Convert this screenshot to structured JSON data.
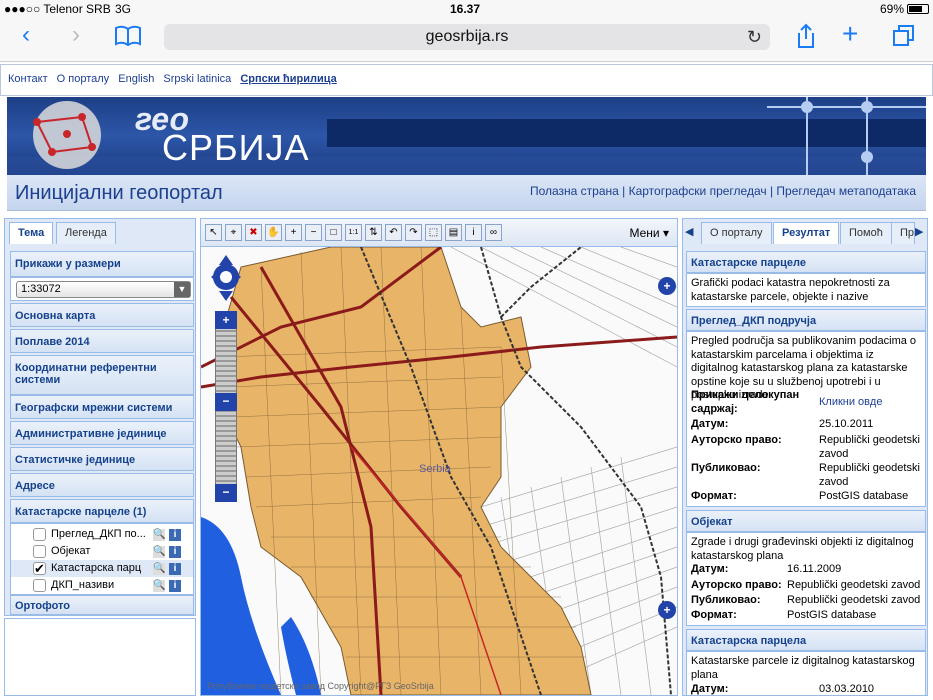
{
  "status": {
    "carrier": "●●●○○ Telenor SRB",
    "network": "3G",
    "time": "16.37",
    "battery": "69%"
  },
  "browser": {
    "url": "geosrbija.rs"
  },
  "toplinks": [
    "Контакт",
    "О порталу",
    "English",
    "Srpski latinica",
    "Српски ћирилица"
  ],
  "banner": {
    "geo": "гео",
    "srbija": "СРБИЈА"
  },
  "subtitle": {
    "title": "Иницијални геопортал",
    "nav": "Полазна страна | Картографски прегледач | Прегледач метаподатака"
  },
  "left": {
    "tabs": [
      "Тема",
      "Легенда"
    ],
    "scale_label": "Прикажи у размери",
    "scale_value": "1:33072",
    "sections": [
      "Основна карта",
      "Поплаве 2014",
      "Координатни референтни системи",
      "Географски мрежни системи",
      "Административне јединице",
      "Статистичке јединице",
      "Адресе",
      "Катастарске парцеле (1)",
      "Ортофото"
    ],
    "layers": [
      {
        "label": "Преглед_ДКП по...",
        "checked": false
      },
      {
        "label": "Објекат",
        "checked": false
      },
      {
        "label": "Катастарска парц",
        "checked": true
      },
      {
        "label": "ДКП_називи",
        "checked": false
      }
    ]
  },
  "map": {
    "menu": "Мени",
    "place": "Serbia",
    "copyright": "Републички геодетски завод Copyright@РГЗ GeoSrbija"
  },
  "right": {
    "tabs": [
      "О порталу",
      "Резултат",
      "Помоћ",
      "Пр"
    ],
    "s1_title": "Катастарске парцеле",
    "s1_text": "Grafički podaci katastra nepokretnosti za katastarske parcele, objekte i nazive",
    "s2_title": "Преглед_ДКП подручја",
    "s2_text": "Pregled područja sa publikovanim podacima o katastarskim parcelama i objektima iz digitalnog katastarskog plana za katastarske opstine koje su u službenoj upotrebi i u postupku izrade",
    "s2_show_k": "Прикажи целокупан садржај:",
    "s2_show_v": "Кликни овде",
    "s2_date_k": "Датум:",
    "s2_date_v": "25.10.2011",
    "s2_copy_k": "Ауторско право:",
    "s2_copy_v": "Republički geodetski zavod",
    "s2_pub_k": "Публиковао:",
    "s2_pub_v": "Republički geodetski zavod",
    "s2_fmt_k": "Формат:",
    "s2_fmt_v": "PostGIS database",
    "s3_title": "Објекат",
    "s3_text": "Zgrade i drugi građevinski objekti iz digitalnog katastarskog plana",
    "s3_date_k": "Датум:",
    "s3_date_v": "16.11.2009",
    "s3_copy_k": "Ауторско право:",
    "s3_copy_v": "Republički geodetski zavod",
    "s3_pub_k": "Публиковао:",
    "s3_pub_v": "Republički geodetski zavod",
    "s3_fmt_k": "Формат:",
    "s3_fmt_v": "PostGIS database",
    "s4_title": "Катастарска парцела",
    "s4_text": "Katastarske parcele iz digitalnog katastarskog plana",
    "s4_date_k": "Датум:",
    "s4_date_v": "03.03.2010"
  },
  "colors": {
    "accent": "#15428b",
    "panel": "#dfe8f6",
    "parcel": "#e8b468",
    "road": "#8b1a1a",
    "water": "#1f5fe0"
  }
}
